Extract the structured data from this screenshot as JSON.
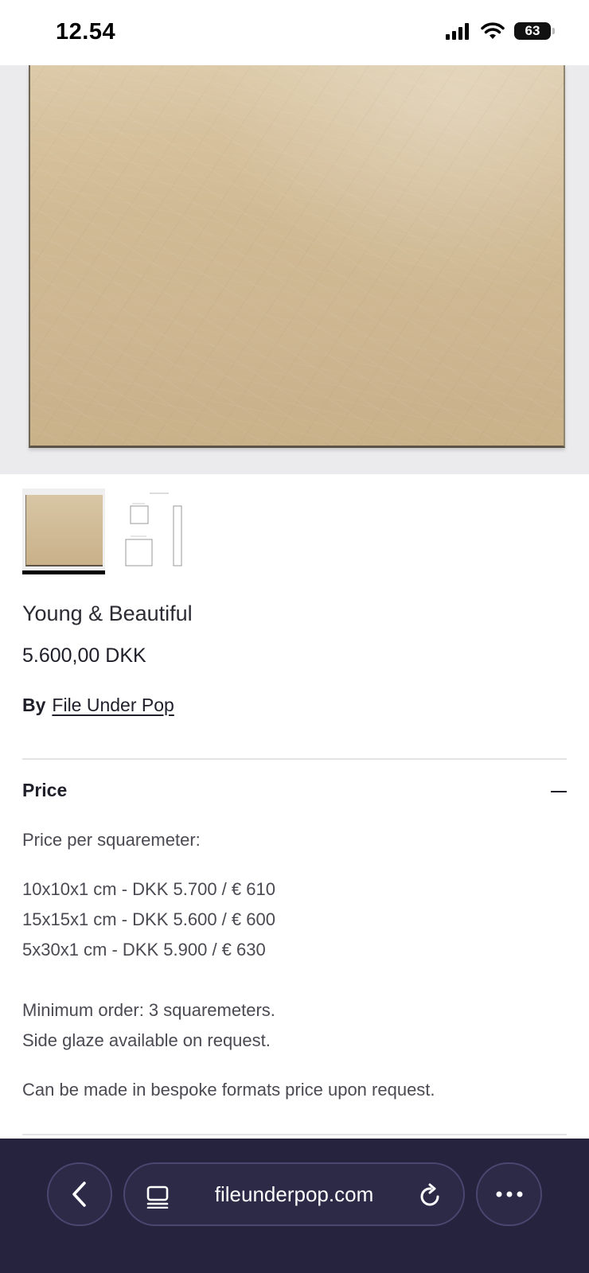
{
  "status_bar": {
    "time": "12.54",
    "battery": "63"
  },
  "product": {
    "title": "Young & Beautiful",
    "price": "5.600,00 DKK",
    "by_label": "By",
    "vendor": "File Under Pop"
  },
  "accordion": {
    "title": "Price",
    "per_label": "Price per squaremeter:",
    "prices": [
      "10x10x1 cm - DKK 5.700 / € 610",
      "15x15x1 cm - DKK 5.600 / € 600",
      "5x30x1 cm - DKK 5.900 / € 630"
    ],
    "minimum_order": "Minimum order: 3 squaremeters.",
    "side_glaze": "Side glaze available on request.",
    "bespoke": "Can be made in bespoke formats price upon request."
  },
  "browser": {
    "url": "fileunderpop.com"
  },
  "icons": {
    "signal": "cellular-signal-icon",
    "wifi": "wifi-icon",
    "battery": "battery-icon",
    "back": "chevron-left-icon",
    "tabs": "tabs-icon",
    "reload": "reload-icon",
    "more": "more-dots-icon"
  },
  "colors": {
    "browser_bar": "#25233d",
    "tile": "#cdb690",
    "text": "#4a4a52"
  }
}
